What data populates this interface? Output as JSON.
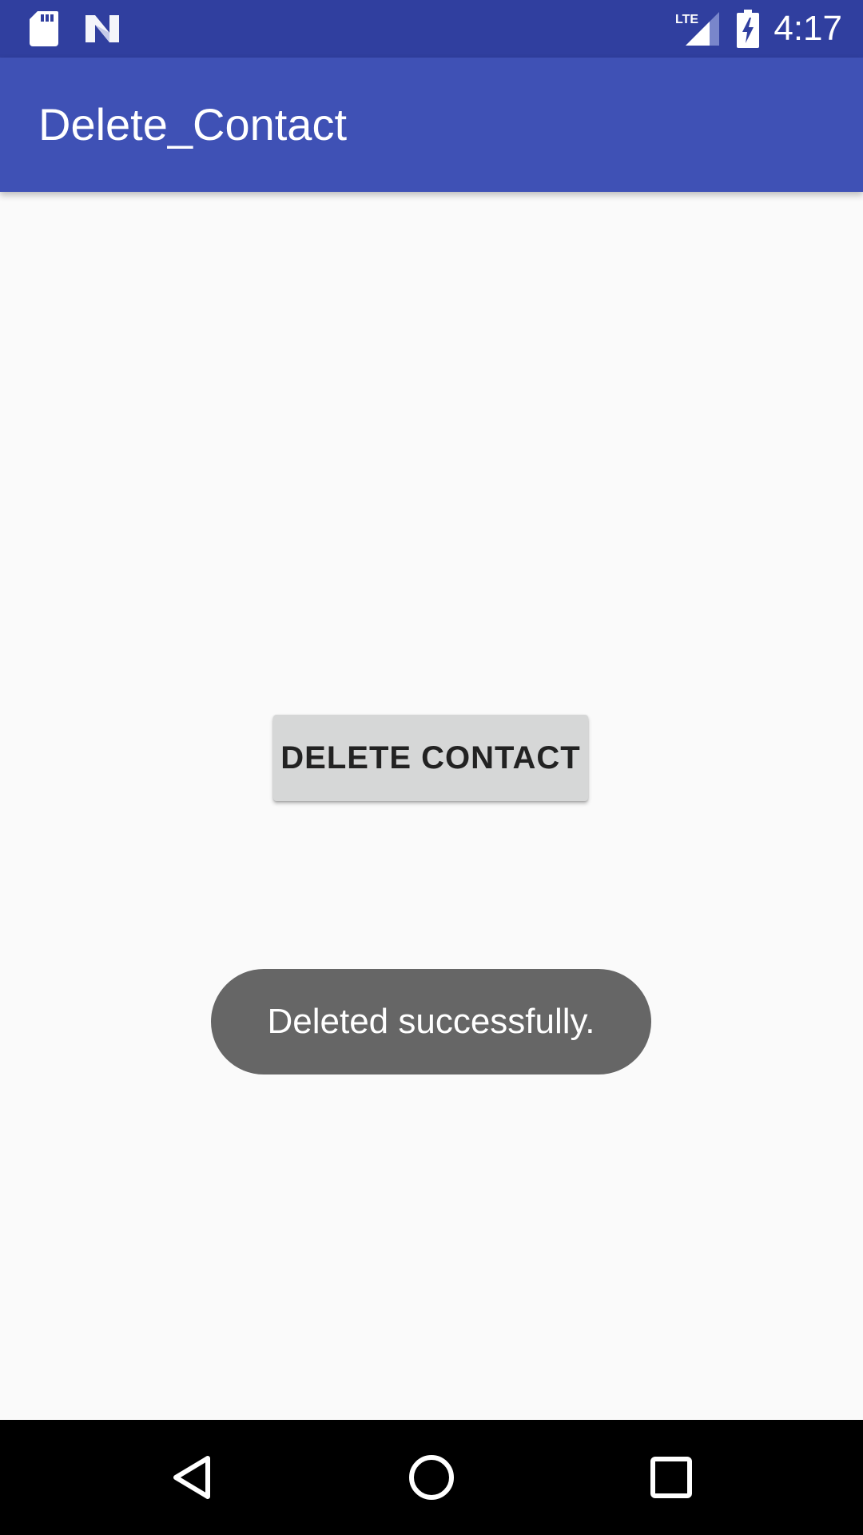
{
  "status_bar": {
    "time": "4:17",
    "left_icons": [
      "sd-card-icon",
      "n-logo-icon"
    ],
    "right_icons": [
      "lte-signal-icon",
      "battery-charging-icon"
    ],
    "network_label": "LTE",
    "background_color": "#303f9f"
  },
  "app_bar": {
    "title": "Delete_Contact",
    "background_color": "#3f51b5"
  },
  "main": {
    "delete_button_label": "DELETE CONTACT",
    "toast_message": "Deleted successfully."
  },
  "nav_bar": {
    "buttons": [
      "back-icon",
      "home-icon",
      "recents-icon"
    ]
  }
}
